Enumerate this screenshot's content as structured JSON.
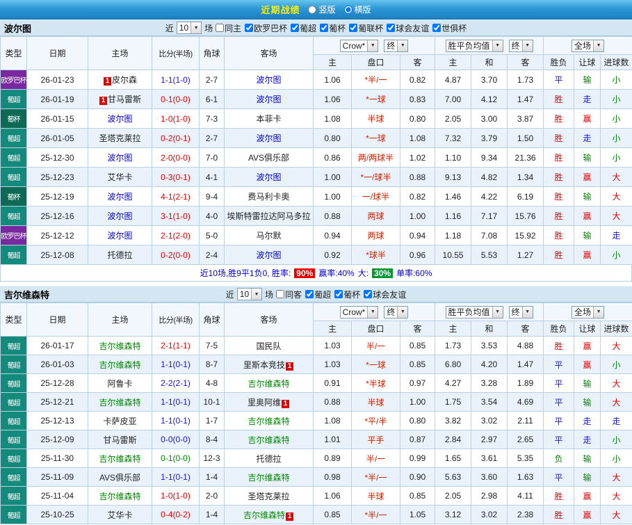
{
  "icons": {
    "chevron_down": "▼"
  },
  "palette": {
    "win_red": "#e60000",
    "draw_blue": "#1616d6",
    "loss_green": "#008800",
    "text_black": "#222222",
    "team_blue": "#0000cc",
    "team_green": "#008800",
    "handicap_red": "#cc2200",
    "summary_blue": "#0000cc",
    "rate_win_bg": "#e60000",
    "rate_big_bg": "#009933",
    "league_colors": {
      "欧罗巴杯": "#7a28a0",
      "葡超": "#148a7d",
      "葡杯": "#0d6b55"
    }
  },
  "top_bar": {
    "title": "近期战绩",
    "radios": [
      {
        "label": "竖版",
        "selected": false
      },
      {
        "label": "横版",
        "selected": true
      }
    ]
  },
  "sections": [
    {
      "team": "波尔图",
      "filter": {
        "near_label": "近",
        "count": "10",
        "games_label": "场",
        "checkboxes": [
          {
            "label": "同主",
            "checked": false
          },
          {
            "label": "欧罗巴杯",
            "checked": true
          },
          {
            "label": "葡超",
            "checked": true
          },
          {
            "label": "葡杯",
            "checked": true
          },
          {
            "label": "葡联杯",
            "checked": true
          },
          {
            "label": "球会友谊",
            "checked": true
          },
          {
            "label": "世俱杯",
            "checked": true
          }
        ]
      },
      "header": {
        "cols": [
          "类型",
          "日期",
          "主场",
          "比分(半场)",
          "角球",
          "客场"
        ],
        "odds_source": "Crow*",
        "odds_final": "终",
        "avg_source": "胜平负均值",
        "avg_final": "终",
        "full_game": "全场",
        "sub": [
          "主",
          "盘口",
          "客",
          "主",
          "和",
          "客",
          "胜负",
          "让球",
          "进球数"
        ]
      },
      "rows": [
        {
          "league": "欧罗巴杯",
          "date": "26-01-23",
          "home": {
            "name": "皮尔森",
            "color": "k",
            "badge": "1",
            "badge_pos": "before"
          },
          "score": {
            "text": "1-1(1-0)",
            "color": "b"
          },
          "corners": "2-7",
          "away": {
            "name": "波尔图",
            "color": "tb"
          },
          "odds": [
            "1.06",
            "*半/一",
            "0.82"
          ],
          "avg_odds": [
            "4.87",
            "3.70",
            "1.73"
          ],
          "results": [
            [
              "平",
              "b"
            ],
            [
              "输",
              "g"
            ],
            [
              "小",
              "g"
            ]
          ]
        },
        {
          "league": "葡超",
          "date": "26-01-19",
          "home": {
            "name": "甘马雷斯",
            "color": "k",
            "badge": "1",
            "badge_pos": "before"
          },
          "score": {
            "text": "0-1(0-0)",
            "color": "r"
          },
          "corners": "6-1",
          "away": {
            "name": "波尔图",
            "color": "tb"
          },
          "odds": [
            "1.06",
            "*一球",
            "0.83"
          ],
          "avg_odds": [
            "7.00",
            "4.12",
            "1.47"
          ],
          "results": [
            [
              "胜",
              "r"
            ],
            [
              "走",
              "b"
            ],
            [
              "小",
              "g"
            ]
          ]
        },
        {
          "league": "葡杯",
          "date": "26-01-15",
          "home": {
            "name": "波尔图",
            "color": "tb"
          },
          "score": {
            "text": "1-0(1-0)",
            "color": "r"
          },
          "corners": "7-3",
          "away": {
            "name": "本菲卡",
            "color": "k"
          },
          "odds": [
            "1.08",
            "半球",
            "0.80"
          ],
          "avg_odds": [
            "2.05",
            "3.00",
            "3.87"
          ],
          "results": [
            [
              "胜",
              "r"
            ],
            [
              "赢",
              "r"
            ],
            [
              "小",
              "g"
            ]
          ]
        },
        {
          "league": "葡超",
          "date": "26-01-05",
          "home": {
            "name": "圣塔克莱拉",
            "color": "k"
          },
          "score": {
            "text": "0-2(0-1)",
            "color": "r"
          },
          "corners": "2-7",
          "away": {
            "name": "波尔图",
            "color": "tb"
          },
          "odds": [
            "0.80",
            "*一球",
            "1.08"
          ],
          "avg_odds": [
            "7.32",
            "3.79",
            "1.50"
          ],
          "results": [
            [
              "胜",
              "r"
            ],
            [
              "走",
              "b"
            ],
            [
              "小",
              "g"
            ]
          ]
        },
        {
          "league": "葡超",
          "date": "25-12-30",
          "home": {
            "name": "波尔图",
            "color": "tb"
          },
          "score": {
            "text": "2-0(0-0)",
            "color": "r"
          },
          "corners": "7-0",
          "away": {
            "name": "AVS俱乐部",
            "color": "k"
          },
          "odds": [
            "0.86",
            "两/两球半",
            "1.02"
          ],
          "avg_odds": [
            "1.10",
            "9.34",
            "21.36"
          ],
          "results": [
            [
              "胜",
              "r"
            ],
            [
              "输",
              "g"
            ],
            [
              "小",
              "g"
            ]
          ]
        },
        {
          "league": "葡超",
          "date": "25-12-23",
          "home": {
            "name": "艾华卡",
            "color": "k"
          },
          "score": {
            "text": "0-3(0-1)",
            "color": "r"
          },
          "corners": "4-1",
          "away": {
            "name": "波尔图",
            "color": "tb"
          },
          "odds": [
            "1.00",
            "*一/球半",
            "0.88"
          ],
          "avg_odds": [
            "9.13",
            "4.82",
            "1.34"
          ],
          "results": [
            [
              "胜",
              "r"
            ],
            [
              "赢",
              "r"
            ],
            [
              "大",
              "r"
            ]
          ]
        },
        {
          "league": "葡杯",
          "date": "25-12-19",
          "home": {
            "name": "波尔图",
            "color": "tb"
          },
          "score": {
            "text": "4-1(2-1)",
            "color": "r"
          },
          "corners": "9-4",
          "away": {
            "name": "费马利卡奥",
            "color": "k"
          },
          "odds": [
            "1.00",
            "一/球半",
            "0.82"
          ],
          "avg_odds": [
            "1.46",
            "4.22",
            "6.19"
          ],
          "results": [
            [
              "胜",
              "r"
            ],
            [
              "输",
              "g"
            ],
            [
              "大",
              "r"
            ]
          ]
        },
        {
          "league": "葡超",
          "date": "25-12-16",
          "home": {
            "name": "波尔图",
            "color": "tb"
          },
          "score": {
            "text": "3-1(1-0)",
            "color": "r"
          },
          "corners": "4-0",
          "away": {
            "name": "埃斯特雷拉达阿马多拉",
            "color": "k"
          },
          "odds": [
            "0.88",
            "两球",
            "1.00"
          ],
          "avg_odds": [
            "1.16",
            "7.17",
            "15.76"
          ],
          "results": [
            [
              "胜",
              "r"
            ],
            [
              "赢",
              "r"
            ],
            [
              "大",
              "r"
            ]
          ]
        },
        {
          "league": "欧罗巴杯",
          "date": "25-12-12",
          "home": {
            "name": "波尔图",
            "color": "tb"
          },
          "score": {
            "text": "2-1(2-0)",
            "color": "r"
          },
          "corners": "5-0",
          "away": {
            "name": "马尔默",
            "color": "k"
          },
          "odds": [
            "0.94",
            "两球",
            "0.94"
          ],
          "avg_odds": [
            "1.18",
            "7.08",
            "15.92"
          ],
          "results": [
            [
              "胜",
              "r"
            ],
            [
              "输",
              "g"
            ],
            [
              "走",
              "b"
            ]
          ]
        },
        {
          "league": "葡超",
          "date": "25-12-08",
          "home": {
            "name": "托德拉",
            "color": "k"
          },
          "score": {
            "text": "0-2(0-0)",
            "color": "r"
          },
          "corners": "2-4",
          "away": {
            "name": "波尔图",
            "color": "tb"
          },
          "odds": [
            "0.92",
            "*球半",
            "0.96"
          ],
          "avg_odds": [
            "10.55",
            "5.53",
            "1.27"
          ],
          "results": [
            [
              "胜",
              "r"
            ],
            [
              "赢",
              "r"
            ],
            [
              "小",
              "g"
            ]
          ]
        }
      ],
      "summary": {
        "prefix": "近10场,胜9平1负0, 胜率:",
        "win_rate": "90%",
        "win_odds_rate": "赢率:40%",
        "big_label": "大:",
        "big_rate": "30%",
        "odd_rate": "单率:60%"
      }
    },
    {
      "team": "吉尔维森特",
      "filter": {
        "near_label": "近",
        "count": "10",
        "games_label": "场",
        "checkboxes": [
          {
            "label": "同客",
            "checked": false
          },
          {
            "label": "葡超",
            "checked": true
          },
          {
            "label": "葡杯",
            "checked": true
          },
          {
            "label": "球会友谊",
            "checked": true
          }
        ]
      },
      "header": {
        "cols": [
          "类型",
          "日期",
          "主场",
          "比分(半场)",
          "角球",
          "客场"
        ],
        "odds_source": "Crow*",
        "odds_final": "终",
        "avg_source": "胜平负均值",
        "avg_final": "终",
        "full_game": "全场",
        "sub": [
          "主",
          "盘口",
          "客",
          "主",
          "和",
          "客",
          "胜负",
          "让球",
          "进球数"
        ]
      },
      "rows": [
        {
          "league": "葡超",
          "date": "26-01-17",
          "home": {
            "name": "吉尔维森特",
            "color": "tg"
          },
          "score": {
            "text": "2-1(1-1)",
            "color": "r"
          },
          "corners": "7-5",
          "away": {
            "name": "国民队",
            "color": "k"
          },
          "odds": [
            "1.03",
            "半/一",
            "0.85"
          ],
          "avg_odds": [
            "1.73",
            "3.53",
            "4.88"
          ],
          "results": [
            [
              "胜",
              "r"
            ],
            [
              "赢",
              "r"
            ],
            [
              "大",
              "r"
            ]
          ]
        },
        {
          "league": "葡超",
          "date": "26-01-03",
          "home": {
            "name": "吉尔维森特",
            "color": "tg"
          },
          "score": {
            "text": "1-1(0-1)",
            "color": "b"
          },
          "corners": "8-7",
          "away": {
            "name": "里斯本竞技",
            "color": "k",
            "badge": "1",
            "badge_pos": "after"
          },
          "odds": [
            "1.03",
            "*一球",
            "0.85"
          ],
          "avg_odds": [
            "6.80",
            "4.20",
            "1.47"
          ],
          "results": [
            [
              "平",
              "b"
            ],
            [
              "赢",
              "r"
            ],
            [
              "小",
              "g"
            ]
          ]
        },
        {
          "league": "葡超",
          "date": "25-12-28",
          "home": {
            "name": "阿鲁卡",
            "color": "k"
          },
          "score": {
            "text": "2-2(2-1)",
            "color": "b"
          },
          "corners": "4-8",
          "away": {
            "name": "吉尔维森特",
            "color": "tg"
          },
          "odds": [
            "0.91",
            "*半球",
            "0.97"
          ],
          "avg_odds": [
            "4.27",
            "3.28",
            "1.89"
          ],
          "results": [
            [
              "平",
              "b"
            ],
            [
              "输",
              "g"
            ],
            [
              "大",
              "r"
            ]
          ]
        },
        {
          "league": "葡超",
          "date": "25-12-21",
          "home": {
            "name": "吉尔维森特",
            "color": "tg"
          },
          "score": {
            "text": "1-1(0-1)",
            "color": "b"
          },
          "corners": "10-1",
          "away": {
            "name": "里奥阿维",
            "color": "k",
            "badge": "1",
            "badge_pos": "after"
          },
          "odds": [
            "0.88",
            "半球",
            "1.00"
          ],
          "avg_odds": [
            "1.75",
            "3.54",
            "4.69"
          ],
          "results": [
            [
              "平",
              "b"
            ],
            [
              "输",
              "g"
            ],
            [
              "大",
              "r"
            ]
          ]
        },
        {
          "league": "葡超",
          "date": "25-12-13",
          "home": {
            "name": "卡萨皮亚",
            "color": "k"
          },
          "score": {
            "text": "1-1(0-1)",
            "color": "b"
          },
          "corners": "1-7",
          "away": {
            "name": "吉尔维森特",
            "color": "tg"
          },
          "odds": [
            "1.08",
            "*平/半",
            "0.80"
          ],
          "avg_odds": [
            "3.82",
            "3.02",
            "2.11"
          ],
          "results": [
            [
              "平",
              "b"
            ],
            [
              "走",
              "b"
            ],
            [
              "走",
              "b"
            ]
          ]
        },
        {
          "league": "葡超",
          "date": "25-12-09",
          "home": {
            "name": "甘马雷斯",
            "color": "k"
          },
          "score": {
            "text": "0-0(0-0)",
            "color": "b"
          },
          "corners": "8-4",
          "away": {
            "name": "吉尔维森特",
            "color": "tg"
          },
          "odds": [
            "1.01",
            "平手",
            "0.87"
          ],
          "avg_odds": [
            "2.84",
            "2.97",
            "2.65"
          ],
          "results": [
            [
              "平",
              "b"
            ],
            [
              "走",
              "b"
            ],
            [
              "小",
              "g"
            ]
          ]
        },
        {
          "league": "葡超",
          "date": "25-11-30",
          "home": {
            "name": "吉尔维森特",
            "color": "tg"
          },
          "score": {
            "text": "0-1(0-0)",
            "color": "g"
          },
          "corners": "12-3",
          "away": {
            "name": "托德拉",
            "color": "k"
          },
          "odds": [
            "0.89",
            "半/一",
            "0.99"
          ],
          "avg_odds": [
            "1.65",
            "3.61",
            "5.35"
          ],
          "results": [
            [
              "负",
              "g"
            ],
            [
              "输",
              "g"
            ],
            [
              "小",
              "g"
            ]
          ]
        },
        {
          "league": "葡超",
          "date": "25-11-09",
          "home": {
            "name": "AVS俱乐部",
            "color": "k"
          },
          "score": {
            "text": "1-1(0-1)",
            "color": "b"
          },
          "corners": "1-4",
          "away": {
            "name": "吉尔维森特",
            "color": "tg"
          },
          "odds": [
            "0.98",
            "*半/一",
            "0.90"
          ],
          "avg_odds": [
            "5.63",
            "3.60",
            "1.63"
          ],
          "results": [
            [
              "平",
              "b"
            ],
            [
              "输",
              "g"
            ],
            [
              "大",
              "r"
            ]
          ]
        },
        {
          "league": "葡超",
          "date": "25-11-04",
          "home": {
            "name": "吉尔维森特",
            "color": "tg"
          },
          "score": {
            "text": "1-0(1-0)",
            "color": "r"
          },
          "corners": "2-0",
          "away": {
            "name": "圣塔克莱拉",
            "color": "k"
          },
          "odds": [
            "1.06",
            "半球",
            "0.85"
          ],
          "avg_odds": [
            "2.05",
            "2.98",
            "4.11"
          ],
          "results": [
            [
              "胜",
              "r"
            ],
            [
              "赢",
              "r"
            ],
            [
              "大",
              "r"
            ]
          ]
        },
        {
          "league": "葡超",
          "date": "25-10-25",
          "home": {
            "name": "艾华卡",
            "color": "k"
          },
          "score": {
            "text": "0-4(0-2)",
            "color": "r"
          },
          "corners": "1-4",
          "away": {
            "name": "吉尔维森特",
            "color": "tg",
            "badge": "1",
            "badge_pos": "after"
          },
          "odds": [
            "0.85",
            "*半/一",
            "1.05"
          ],
          "avg_odds": [
            "3.12",
            "3.02",
            "2.38"
          ],
          "results": [
            [
              "胜",
              "r"
            ],
            [
              "赢",
              "r"
            ],
            [
              "大",
              "r"
            ]
          ]
        }
      ]
    }
  ]
}
